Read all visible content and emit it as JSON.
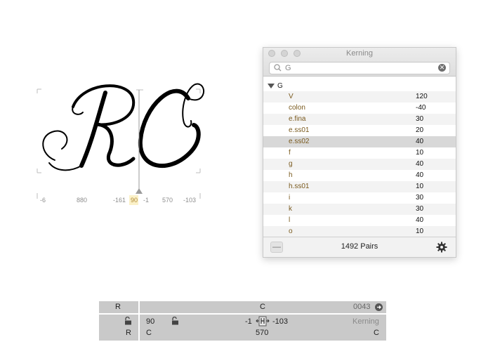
{
  "canvas": {
    "metrics": [
      "-6",
      "880",
      "-161",
      "90",
      "-1",
      "570",
      "-103"
    ]
  },
  "kerning_window": {
    "title": "Kerning",
    "search": {
      "value": "G"
    },
    "group": {
      "label": "G"
    },
    "pairs": [
      {
        "name": "V",
        "value": "120"
      },
      {
        "name": "colon",
        "value": "-40"
      },
      {
        "name": "e.fina",
        "value": "30"
      },
      {
        "name": "e.ss01",
        "value": "20"
      },
      {
        "name": "e.ss02",
        "value": "40"
      },
      {
        "name": "f",
        "value": "10"
      },
      {
        "name": "g",
        "value": "40"
      },
      {
        "name": "h",
        "value": "40"
      },
      {
        "name": "h.ss01",
        "value": "10"
      },
      {
        "name": "i",
        "value": "30"
      },
      {
        "name": "k",
        "value": "30"
      },
      {
        "name": "l",
        "value": "40"
      },
      {
        "name": "o",
        "value": "10"
      }
    ],
    "selected_index": 4,
    "remove_label": "—",
    "pair_count": "1492 Pairs"
  },
  "metrics_bar": {
    "left_glyph": "R",
    "right_glyph": "C",
    "unicode": "0043",
    "left_rsb": "90",
    "kern_value": "-1",
    "right_lsb": "-103",
    "mode_label": "Kerning",
    "left_group": "R",
    "right_group_left": "C",
    "right_width": "570",
    "right_group_right": "C"
  },
  "colors": {
    "panel": "#c9c9c9",
    "selection": "#d8d8d8",
    "glyph": "#000000"
  }
}
